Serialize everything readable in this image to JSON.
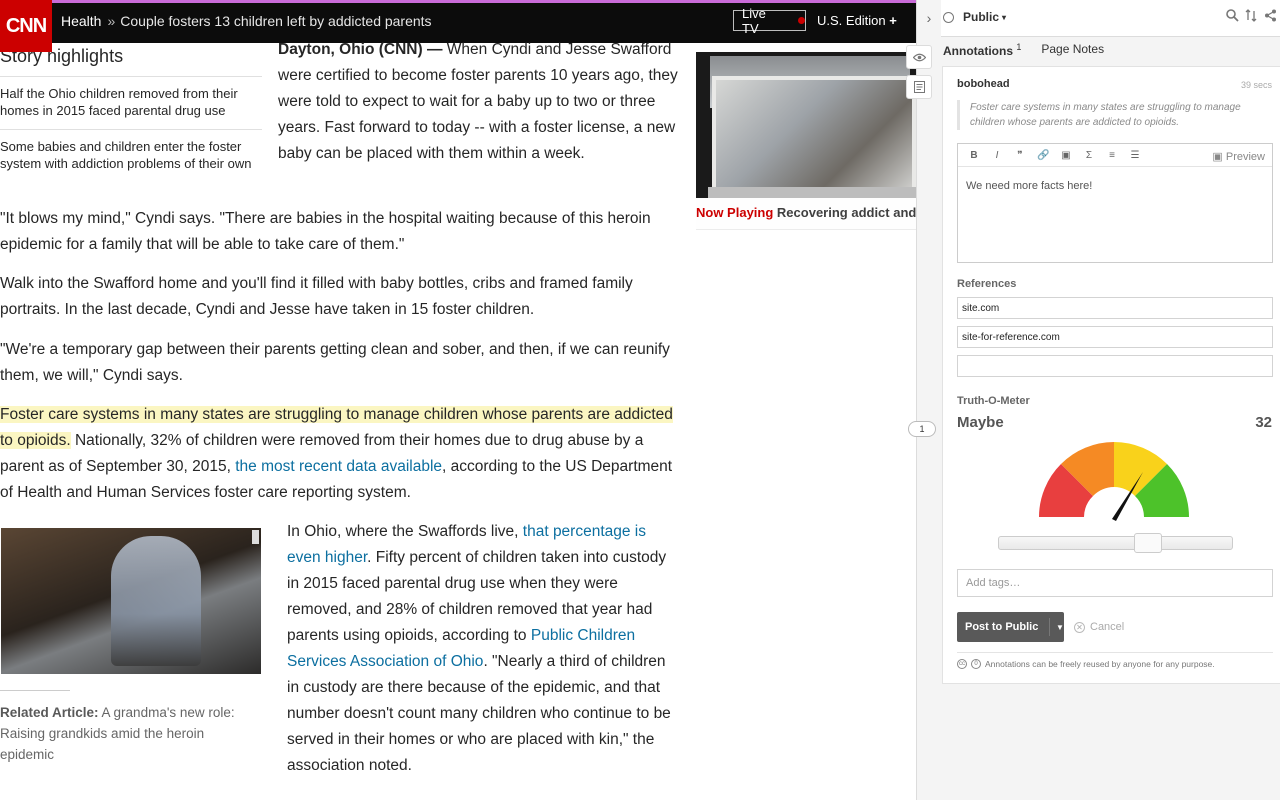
{
  "header": {
    "logo": "CNN",
    "section": "Health",
    "separator": "»",
    "headline": "Couple fosters 13 children left by addicted parents",
    "live_tv": "Live TV",
    "edition": "U.S. Edition",
    "edition_plus": "+"
  },
  "highlights": {
    "title": "Story highlights",
    "items": [
      "Half the Ohio children removed from their homes in 2015 faced parental drug use",
      "Some babies and children enter the foster system with addiction problems of their own"
    ]
  },
  "article": {
    "lead_dateline": "Dayton, Ohio (CNN) —",
    "lead_text": " When Cyndi and Jesse Swafford were certified to become foster parents 10 years ago, they were told to expect to wait for a baby up to two or three years. Fast forward to today -- with a foster license, a new baby can be placed with them within a week.",
    "p2": "\"It blows my mind,\" Cyndi says. \"There are babies in the hospital waiting because of this heroin epidemic for a family that will be able to take care of them.\"",
    "p3": "Walk into the Swafford home and you'll find it filled with baby bottles, cribs and framed family portraits. In the last decade, Cyndi and Jesse have taken in 15 foster children.",
    "p4": "\"We're a temporary gap between their parents getting clean and sober, and then, if we can reunify them, we will,\" Cyndi says.",
    "p5_highlight": "Foster care systems in many states are struggling to manage children whose parents are addicted to opioids.",
    "p5_text": " Nationally, 32% of children were removed from their homes due to drug abuse by a parent as of September 30, 2015, ",
    "p5_link": "the most recent data available",
    "p5_end": ", according to the US Department of Health and Human Services foster care reporting system.",
    "p6_start": "In Ohio, where the Swaffords live, ",
    "p6_link1": "that percentage is even higher",
    "p6_mid": ". Fifty percent of children taken into custody in 2015 faced parental drug use when they were removed, and 28% of children removed that year had parents using opioids, according to ",
    "p6_link2": "Public Children Services Association of Ohio",
    "p6_end": ". \"Nearly a third of children in custody are there because of the epidemic, and that number doesn't count many children who continue to be served in their homes or who are placed with kin,\" the association noted.",
    "related_label": "Related Article:",
    "related_text": " A grandma's new role: Raising grandkids amid the heroin epidemic"
  },
  "video": {
    "now_playing": "Now Playing",
    "title": "Recovering addict and..."
  },
  "gutter": {
    "collapse_icon": "chevron-right-icon",
    "eye_icon": "eye-icon",
    "notes_icon": "notes-icon",
    "badge": "1"
  },
  "sidebar": {
    "scope": "Public",
    "tabs": [
      {
        "label": "Annotations",
        "count": "1"
      },
      {
        "label": "Page Notes"
      }
    ],
    "annotation": {
      "user": "bobohead",
      "time": "39 secs",
      "quote": "Foster care systems in many states are struggling to manage children whose parents are addicted to opioids.",
      "toolbar": [
        "B",
        "I",
        "❞",
        "🔗",
        "▣",
        "Σ",
        "≡",
        "☰"
      ],
      "preview": "Preview",
      "body": "We need more facts here!"
    },
    "references_label": "References",
    "references": [
      "site.com",
      "site-for-reference.com",
      ""
    ],
    "truth_label": "Truth-O-Meter",
    "truth_value": "Maybe",
    "truth_score": "32",
    "tags_placeholder": "Add tags…",
    "post_button": "Post to Public",
    "cancel": "Cancel",
    "license": "Annotations can be freely reused by anyone for any purpose."
  },
  "colors": {
    "cnn_red": "#cc0000",
    "highlight": "#fbf6c2",
    "link": "#0c6fa0",
    "gauge": [
      "#e83f3f",
      "#f58a24",
      "#f9d21b",
      "#4dc22a"
    ]
  }
}
